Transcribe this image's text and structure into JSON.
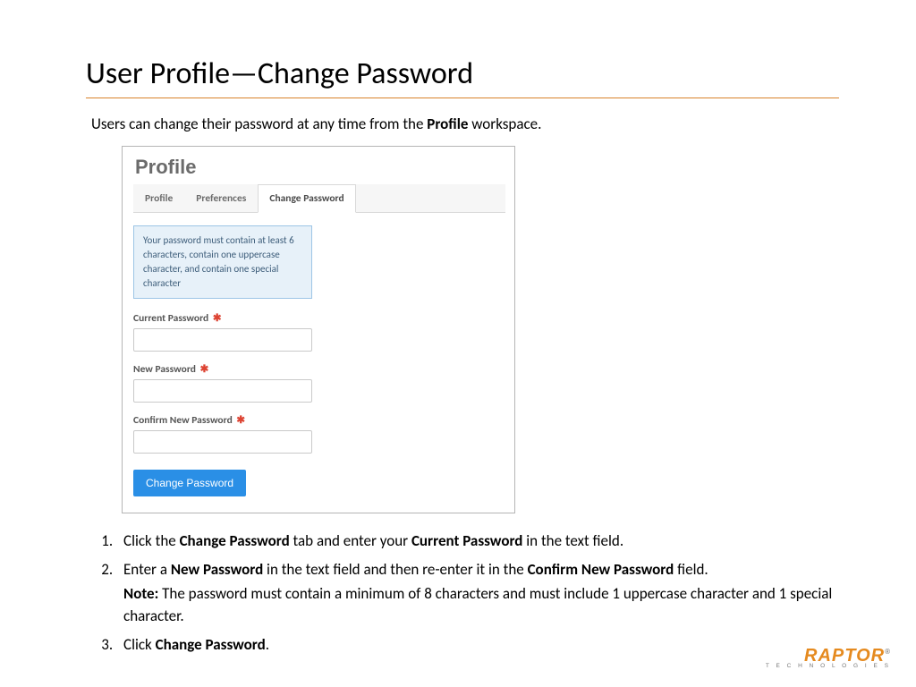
{
  "title": "User Profile—Change Password",
  "intro_pre": "Users can change their password at any time from the ",
  "intro_bold": "Profile",
  "intro_post": " workspace.",
  "panel": {
    "heading": "Profile",
    "tabs": {
      "profile": "Profile",
      "preferences": "Preferences",
      "change": "Change Password"
    },
    "hint": "Your password must contain at least 6 characters, contain one uppercase character, and contain one special character",
    "labels": {
      "current": "Current Password",
      "new": "New Password",
      "confirm": "Confirm New Password"
    },
    "required": "✱",
    "button": "Change Password"
  },
  "steps": {
    "s1_pre": "Click the ",
    "s1_b1": "Change Password",
    "s1_mid": " tab and enter your ",
    "s1_b2": "Current Password",
    "s1_post": " in the text field.",
    "s2_pre": "Enter a ",
    "s2_b1": "New Password",
    "s2_mid": " in the text field and then re-enter it in the ",
    "s2_b2": "Confirm New Password",
    "s2_post": " field.",
    "note_b": "Note:",
    "note_txt": " The password must contain a minimum of 8 characters and must include 1 uppercase character and 1 special character.",
    "s3_pre": "Click ",
    "s3_b": "Change Password",
    "s3_post": "."
  },
  "logo": {
    "brand": "RAPTOR",
    "reg": "®",
    "sub": "T E C H N O L O G I E S"
  }
}
